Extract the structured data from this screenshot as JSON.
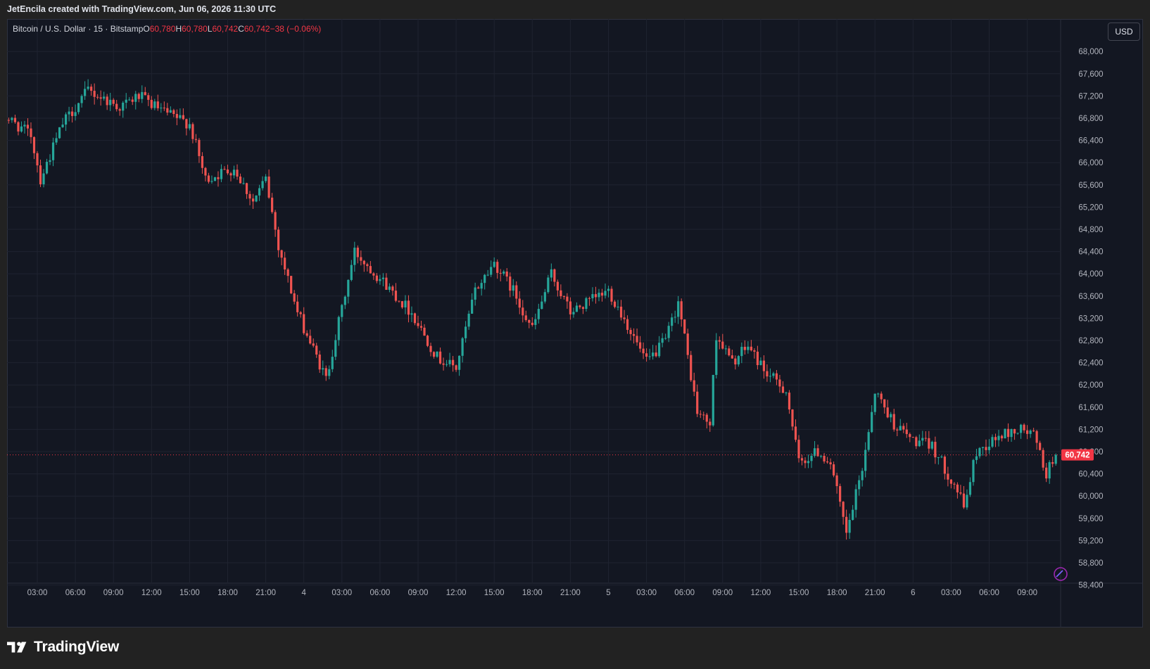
{
  "header": {
    "attribution": "JetEncila created with TradingView.com, Jun 06, 2026 11:30 UTC"
  },
  "legend": {
    "symbol": "Bitcoin / U.S. Dollar · 15 · Bitstamp",
    "open_label": "O",
    "open": "60,780",
    "high_label": "H",
    "high": "60,780",
    "low_label": "L",
    "low": "60,742",
    "close_label": "C",
    "close": "60,742",
    "change": "−38 (−0.06%)"
  },
  "currency_button": "USD",
  "footer": {
    "brand": "TradingView"
  },
  "colors": {
    "up": "#26a69a",
    "down": "#ef5350",
    "background": "#131722",
    "grid": "#1f2330",
    "axis_text": "#b2b5be",
    "last_price": "#f23645"
  },
  "chart_data": {
    "type": "candlestick",
    "title": "Bitcoin / U.S. Dollar · 15 · Bitstamp",
    "xlabel": "",
    "ylabel": "",
    "ylim": [
      58200,
      68200
    ],
    "y_ticks": [
      "68,000",
      "67,600",
      "67,200",
      "66,800",
      "66,400",
      "66,000",
      "65,600",
      "65,200",
      "64,800",
      "64,400",
      "64,000",
      "63,600",
      "63,200",
      "62,800",
      "62,400",
      "62,000",
      "61,600",
      "61,200",
      "60,800",
      "60,400",
      "60,000",
      "59,600",
      "59,200",
      "58,800",
      "58,400"
    ],
    "x_ticks": [
      "03:00",
      "06:00",
      "09:00",
      "12:00",
      "15:00",
      "18:00",
      "21:00",
      "4",
      "03:00",
      "06:00",
      "09:00",
      "12:00",
      "15:00",
      "18:00",
      "21:00",
      "5",
      "03:00",
      "06:00",
      "09:00",
      "12:00",
      "15:00",
      "18:00",
      "21:00",
      "6",
      "03:00",
      "06:00",
      "09:00"
    ],
    "last_price": "60,742",
    "key_points": [
      {
        "t": "Jun 3 00:00",
        "price": 66900
      },
      {
        "t": "Jun 3 02:30",
        "price": 66500
      },
      {
        "t": "Jun 3 03:15",
        "price": 65700
      },
      {
        "t": "Jun 3 05:00",
        "price": 66700
      },
      {
        "t": "Jun 3 07:00",
        "price": 67300
      },
      {
        "t": "Jun 3 09:30",
        "price": 67000
      },
      {
        "t": "Jun 3 11:00",
        "price": 67200
      },
      {
        "t": "Jun 3 13:00",
        "price": 66900
      },
      {
        "t": "Jun 3 15:00",
        "price": 66700
      },
      {
        "t": "Jun 3 16:15",
        "price": 65700
      },
      {
        "t": "Jun 3 18:30",
        "price": 65900
      },
      {
        "t": "Jun 3 20:00",
        "price": 65300
      },
      {
        "t": "Jun 3 21:00",
        "price": 65700
      },
      {
        "t": "Jun 3 22:00",
        "price": 64500
      },
      {
        "t": "Jun 3 23:30",
        "price": 63300
      },
      {
        "t": "Jun 4 01:45",
        "price": 62100
      },
      {
        "t": "Jun 4 04:00",
        "price": 64400
      },
      {
        "t": "Jun 4 06:30",
        "price": 63800
      },
      {
        "t": "Jun 4 08:30",
        "price": 63300
      },
      {
        "t": "Jun 4 10:30",
        "price": 62500
      },
      {
        "t": "Jun 4 12:00",
        "price": 62300
      },
      {
        "t": "Jun 4 13:30",
        "price": 63700
      },
      {
        "t": "Jun 4 15:00",
        "price": 64200
      },
      {
        "t": "Jun 4 16:30",
        "price": 63700
      },
      {
        "t": "Jun 4 18:00",
        "price": 63000
      },
      {
        "t": "Jun 4 19:30",
        "price": 64000
      },
      {
        "t": "Jun 4 21:00",
        "price": 63300
      },
      {
        "t": "Jun 4 22:30",
        "price": 63500
      },
      {
        "t": "Jun 5 00:00",
        "price": 63700
      },
      {
        "t": "Jun 5 01:00",
        "price": 63300
      },
      {
        "t": "Jun 5 03:00",
        "price": 62400
      },
      {
        "t": "Jun 5 04:30",
        "price": 62800
      },
      {
        "t": "Jun 5 05:30",
        "price": 63500
      },
      {
        "t": "Jun 5 07:00",
        "price": 61500
      },
      {
        "t": "Jun 5 08:00",
        "price": 61300
      },
      {
        "t": "Jun 5 08:30",
        "price": 62900
      },
      {
        "t": "Jun 5 09:45",
        "price": 62400
      },
      {
        "t": "Jun 5 11:00",
        "price": 62700
      },
      {
        "t": "Jun 5 12:30",
        "price": 62200
      },
      {
        "t": "Jun 5 14:00",
        "price": 61900
      },
      {
        "t": "Jun 5 15:00",
        "price": 60600
      },
      {
        "t": "Jun 5 16:30",
        "price": 60800
      },
      {
        "t": "Jun 5 17:30",
        "price": 60600
      },
      {
        "t": "Jun 5 18:45",
        "price": 59300
      },
      {
        "t": "Jun 5 20:00",
        "price": 60500
      },
      {
        "t": "Jun 5 21:00",
        "price": 61900
      },
      {
        "t": "Jun 5 22:30",
        "price": 61300
      },
      {
        "t": "Jun 6 00:00",
        "price": 61000
      },
      {
        "t": "Jun 6 01:30",
        "price": 60900
      },
      {
        "t": "Jun 6 03:30",
        "price": 60100
      },
      {
        "t": "Jun 6 04:00",
        "price": 59800
      },
      {
        "t": "Jun 6 05:00",
        "price": 60800
      },
      {
        "t": "Jun 6 07:00",
        "price": 61100
      },
      {
        "t": "Jun 6 08:30",
        "price": 61200
      },
      {
        "t": "Jun 6 09:30",
        "price": 61100
      },
      {
        "t": "Jun 6 10:30",
        "price": 60400
      },
      {
        "t": "Jun 6 11:15",
        "price": 60742
      }
    ]
  }
}
